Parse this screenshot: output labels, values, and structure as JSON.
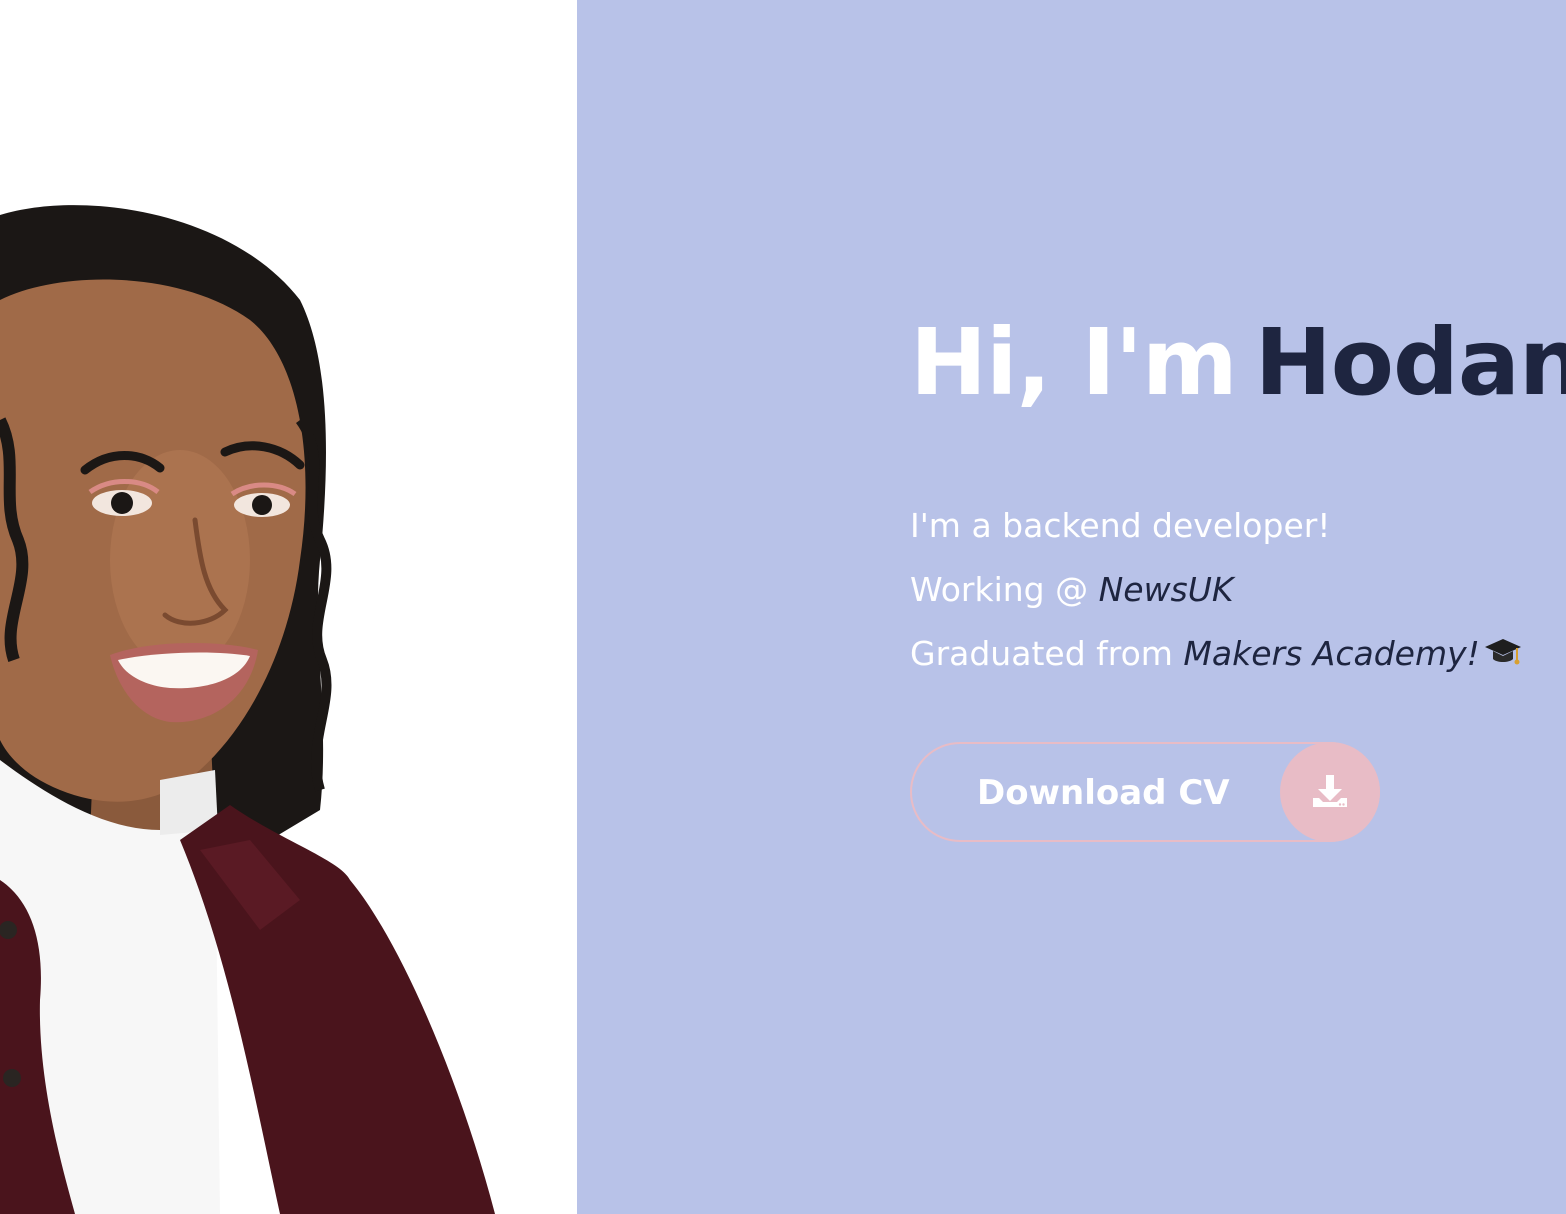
{
  "colors": {
    "panel_background": "#b8c2e8",
    "accent_dark": "#1e2540",
    "text_light": "#ffffff",
    "button_pink": "#e8bcc6"
  },
  "photo": {
    "icon": "portrait-photo"
  },
  "hero": {
    "greeting": "Hi, I'm",
    "name": "Hodan",
    "lines": [
      {
        "text": "I'm a backend developer!",
        "accent": ""
      },
      {
        "text": "Working @ ",
        "accent": "NewsUK"
      },
      {
        "text": "Graduated from ",
        "accent": "Makers Academy!"
      }
    ],
    "cap_icon": "graduation-cap-icon"
  },
  "cv_button": {
    "label": "Download CV",
    "icon": "download-icon"
  }
}
